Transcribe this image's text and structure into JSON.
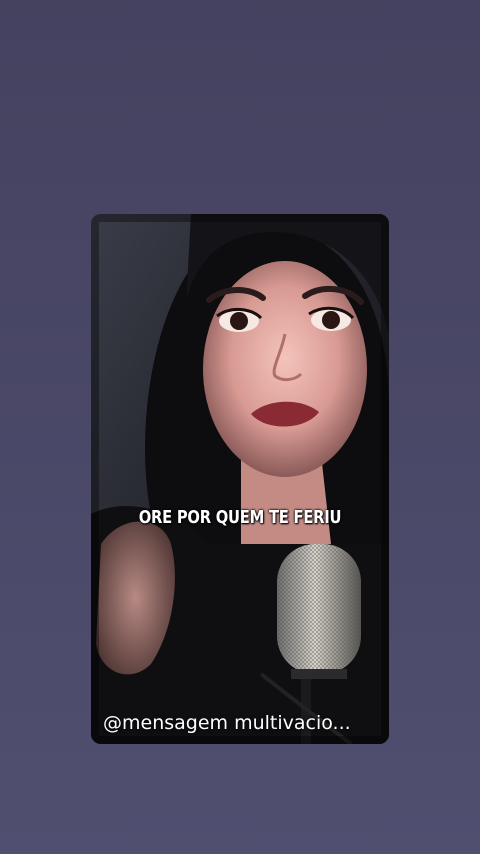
{
  "video": {
    "caption": "ORE POR QUEM TE FERIU",
    "channel_handle": "@mensagem multivacio",
    "handle_ellipsis": "..."
  },
  "colors": {
    "background": "#48465f",
    "caption_text": "#ffffff"
  },
  "icons": [
    "microphone-icon"
  ]
}
